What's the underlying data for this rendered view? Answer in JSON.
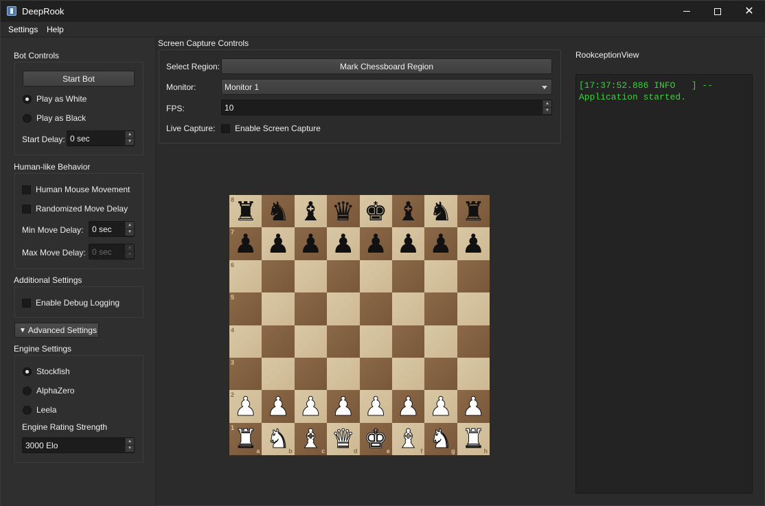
{
  "window": {
    "title": "DeepRook"
  },
  "menubar": {
    "items": [
      "Settings",
      "Help"
    ]
  },
  "bot_controls": {
    "title": "Bot Controls",
    "start_button": "Start Bot",
    "play_white": "Play as White",
    "play_black": "Play as Black",
    "start_delay_label": "Start Delay:",
    "start_delay_value": "0 sec"
  },
  "human_behavior": {
    "title": "Human-like Behavior",
    "mouse_movement": "Human Mouse Movement",
    "randomized_delay": "Randomized Move Delay",
    "min_delay_label": "Min Move Delay:",
    "min_delay_value": "0 sec",
    "max_delay_label": "Max Move Delay:",
    "max_delay_value": "0 sec"
  },
  "additional_settings": {
    "title": "Additional Settings",
    "debug_logging": "Enable Debug Logging"
  },
  "advanced_button": "Advanced Settings",
  "engine_settings": {
    "title": "Engine Settings",
    "engines": [
      "Stockfish",
      "AlphaZero",
      "Leela"
    ],
    "selected": "Stockfish",
    "rating_label": "Engine Rating Strength",
    "rating_value": "3000 Elo"
  },
  "screen_capture": {
    "title": "Screen Capture Controls",
    "select_region_label": "Select Region:",
    "mark_button": "Mark Chessboard Region",
    "monitor_label": "Monitor:",
    "monitor_value": "Monitor 1",
    "fps_label": "FPS:",
    "fps_value": "10",
    "live_capture_label": "Live Capture:",
    "enable_capture": "Enable Screen Capture"
  },
  "board": {
    "ranks": [
      "8",
      "7",
      "6",
      "5",
      "4",
      "3",
      "2",
      "1"
    ],
    "files": [
      "a",
      "b",
      "c",
      "d",
      "e",
      "f",
      "g",
      "h"
    ],
    "position": [
      [
        "bR",
        "bN",
        "bB",
        "bQ",
        "bK",
        "bB",
        "bN",
        "bR"
      ],
      [
        "bP",
        "bP",
        "bP",
        "bP",
        "bP",
        "bP",
        "bP",
        "bP"
      ],
      [
        "",
        "",
        "",
        "",
        "",
        "",
        "",
        ""
      ],
      [
        "",
        "",
        "",
        "",
        "",
        "",
        "",
        ""
      ],
      [
        "",
        "",
        "",
        "",
        "",
        "",
        "",
        ""
      ],
      [
        "",
        "",
        "",
        "",
        "",
        "",
        "",
        ""
      ],
      [
        "wP",
        "wP",
        "wP",
        "wP",
        "wP",
        "wP",
        "wP",
        "wP"
      ],
      [
        "wR",
        "wN",
        "wB",
        "wQ",
        "wK",
        "wB",
        "wN",
        "wR"
      ]
    ]
  },
  "rookception": {
    "title": "RookceptionView",
    "log": "[17:37:52.886 INFO   ] -- Application started."
  }
}
